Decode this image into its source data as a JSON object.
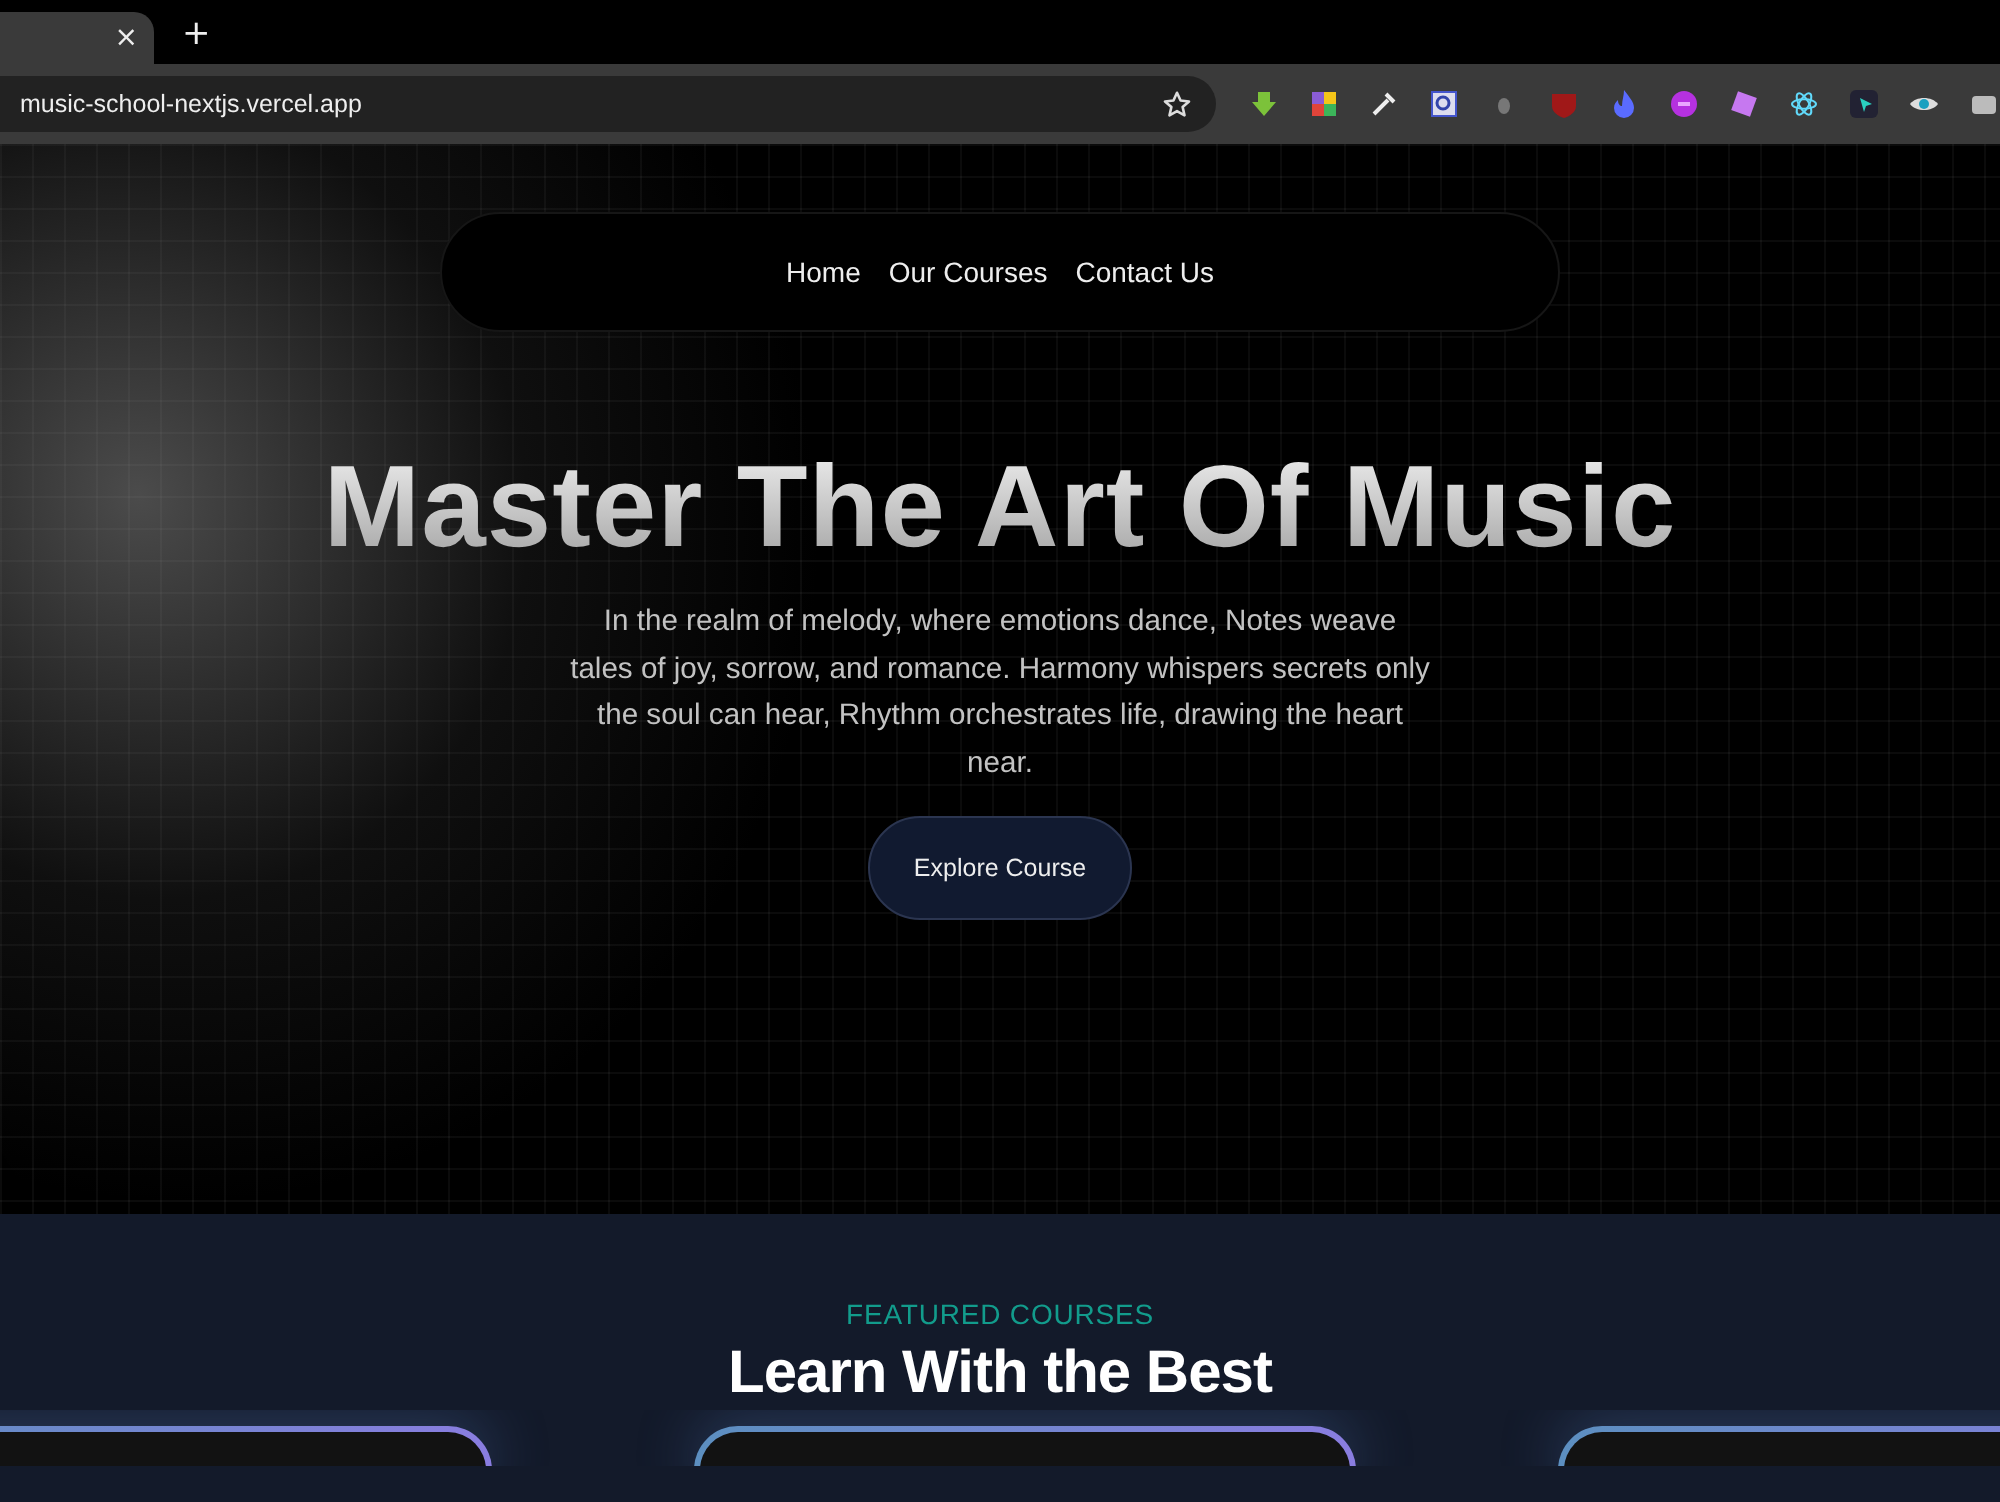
{
  "browser": {
    "tab": {
      "close": "×"
    },
    "new_tab": "+",
    "address": "music-school-nextjs.vercel.app"
  },
  "nav": {
    "links": [
      {
        "label": "Home"
      },
      {
        "label": "Our Courses"
      },
      {
        "label": "Contact Us"
      }
    ]
  },
  "hero": {
    "title": "Master The Art Of Music",
    "text": "In the realm of melody, where emotions dance, Notes weave tales of joy, sorrow, and romance. Harmony whispers secrets only the soul can hear, Rhythm orchestrates life, drawing the heart near.",
    "button": "Explore Course"
  },
  "featured": {
    "eyebrow": "FEATURED COURSES",
    "title": "Learn With the Best"
  }
}
